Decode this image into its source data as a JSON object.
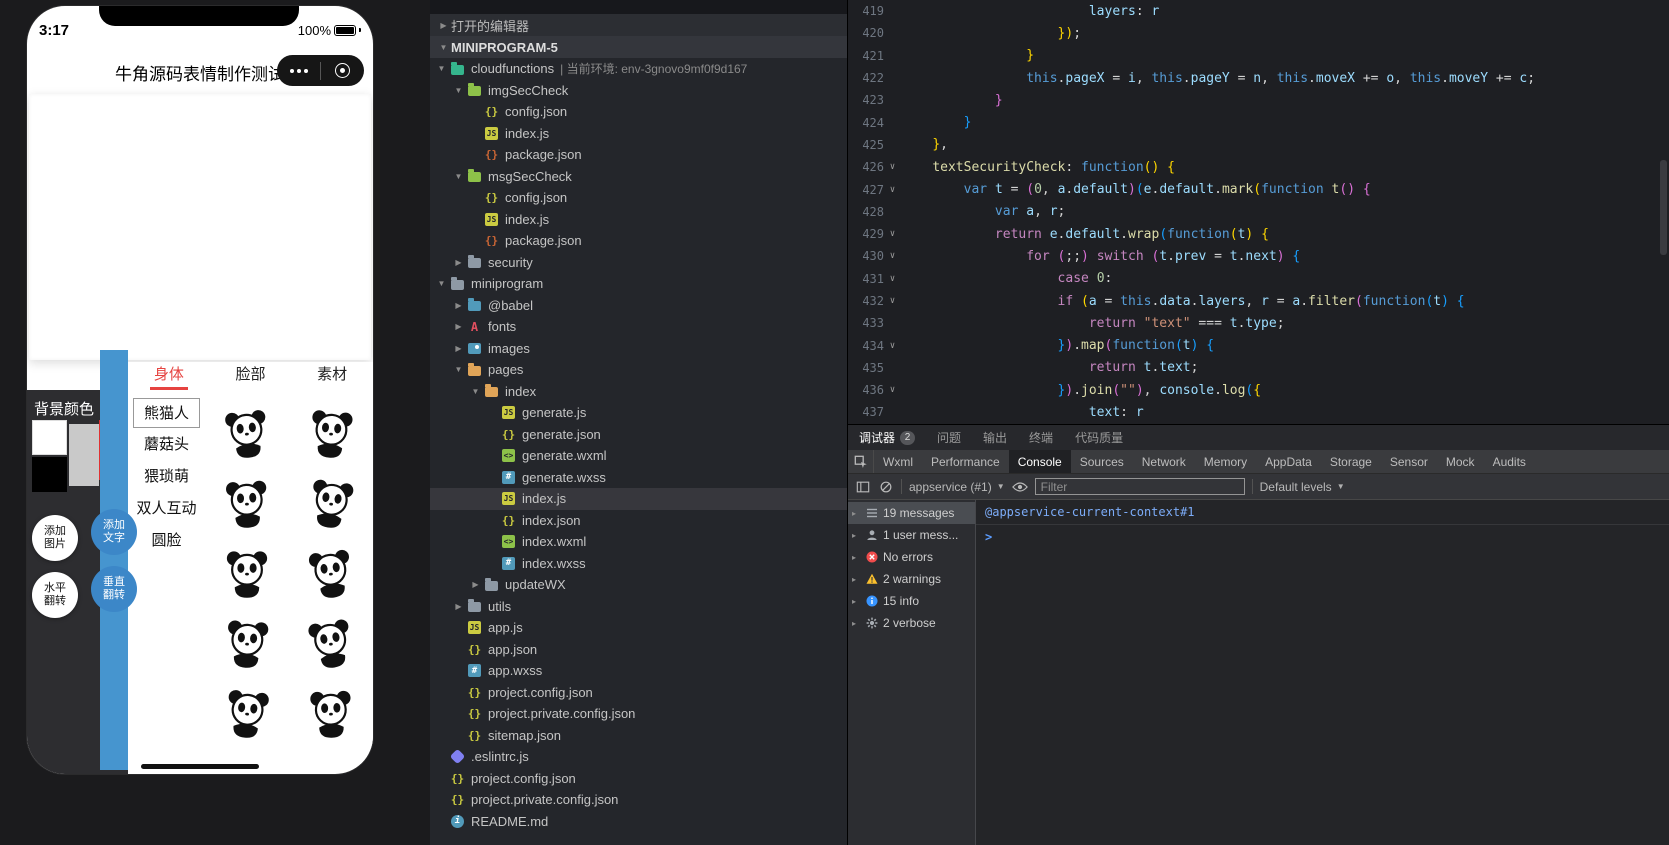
{
  "icons": {
    "collapsed": "▶",
    "expanded": "▼",
    "disclosure": "▸",
    "caret": "▼",
    "fold": "∨"
  },
  "simulator": {
    "status": {
      "time": "3:17",
      "battery": "100%"
    },
    "navbar": {
      "title": "牛角源码表情制作测试"
    },
    "sheet_tabs": [
      {
        "label": "身体",
        "active": true
      },
      {
        "label": "脸部",
        "active": false
      },
      {
        "label": "素材",
        "active": false
      }
    ],
    "bg_color_label": "背景颜色",
    "swatches": [
      "#ffffff",
      "#c9c9c9",
      "#000000"
    ],
    "categories": [
      {
        "label": "熊猫人",
        "selected": true
      },
      {
        "label": "蘑菇头",
        "selected": false
      },
      {
        "label": "猥琐萌",
        "selected": false
      },
      {
        "label": "双人互动",
        "selected": false
      },
      {
        "label": "圆脸",
        "selected": false
      }
    ],
    "action_buttons": [
      {
        "label": "添加图片",
        "style": "white"
      },
      {
        "label": "添加文字",
        "style": "blue"
      },
      {
        "label": "水平翻转",
        "style": "white"
      },
      {
        "label": "垂直翻转",
        "style": "blue"
      }
    ],
    "stickers": {
      "count": 10,
      "kind": "panda-sticker"
    },
    "accent_blue": "#4695cf",
    "tab_red": "#e64340"
  },
  "explorer": {
    "open_editors_label": "打开的编辑器",
    "root_label": "MINIPROGRAM-5",
    "items": [
      {
        "indent": 0,
        "arrow": "open",
        "icon": "folder-cloud",
        "label": "cloudfunctions",
        "note": "| 当前环境: env-3gnovo9mf0f9d167"
      },
      {
        "indent": 1,
        "arrow": "open",
        "icon": "folder-green",
        "label": "imgSecCheck"
      },
      {
        "indent": 2,
        "icon": "file-json",
        "label": "config.json"
      },
      {
        "indent": 2,
        "icon": "file-js",
        "label": "index.js"
      },
      {
        "indent": 2,
        "icon": "file-pkg",
        "label": "package.json"
      },
      {
        "indent": 1,
        "arrow": "open",
        "icon": "folder-green",
        "label": "msgSecCheck"
      },
      {
        "indent": 2,
        "icon": "file-json",
        "label": "config.json"
      },
      {
        "indent": 2,
        "icon": "file-js",
        "label": "index.js"
      },
      {
        "indent": 2,
        "icon": "file-pkg",
        "label": "package.json"
      },
      {
        "indent": 1,
        "arrow": "closed",
        "icon": "folder-gray",
        "label": "security"
      },
      {
        "indent": 0,
        "arrow": "open",
        "icon": "folder-gray",
        "label": "miniprogram"
      },
      {
        "indent": 1,
        "arrow": "closed",
        "icon": "folder-blue",
        "label": "@babel"
      },
      {
        "indent": 1,
        "arrow": "closed",
        "icon": "fonts-icon",
        "label": "fonts"
      },
      {
        "indent": 1,
        "arrow": "closed",
        "icon": "images-icon",
        "label": "images"
      },
      {
        "indent": 1,
        "arrow": "open",
        "icon": "folder-orange",
        "label": "pages"
      },
      {
        "indent": 2,
        "arrow": "open",
        "icon": "folder-orange",
        "label": "index"
      },
      {
        "indent": 3,
        "icon": "file-js",
        "label": "generate.js"
      },
      {
        "indent": 3,
        "icon": "file-json",
        "label": "generate.json"
      },
      {
        "indent": 3,
        "icon": "file-wxml",
        "label": "generate.wxml"
      },
      {
        "indent": 3,
        "icon": "file-wxss",
        "label": "generate.wxss"
      },
      {
        "indent": 3,
        "icon": "file-js",
        "label": "index.js",
        "selected": true
      },
      {
        "indent": 3,
        "icon": "file-json",
        "label": "index.json"
      },
      {
        "indent": 3,
        "icon": "file-wxml",
        "label": "index.wxml"
      },
      {
        "indent": 3,
        "icon": "file-wxss",
        "label": "index.wxss"
      },
      {
        "indent": 2,
        "arrow": "closed",
        "icon": "folder-gray",
        "label": "updateWX"
      },
      {
        "indent": 1,
        "arrow": "closed",
        "icon": "folder-gray",
        "label": "utils"
      },
      {
        "indent": 1,
        "icon": "file-js",
        "label": "app.js"
      },
      {
        "indent": 1,
        "icon": "file-json",
        "label": "app.json"
      },
      {
        "indent": 1,
        "icon": "file-wxss",
        "label": "app.wxss"
      },
      {
        "indent": 1,
        "icon": "file-json",
        "label": "project.config.json"
      },
      {
        "indent": 1,
        "icon": "file-json",
        "label": "project.private.config.json"
      },
      {
        "indent": 1,
        "icon": "file-json",
        "label": "sitemap.json"
      },
      {
        "indent": 0,
        "icon": "file-eslint",
        "label": ".eslintrc.js"
      },
      {
        "indent": 0,
        "icon": "file-json",
        "label": "project.config.json"
      },
      {
        "indent": 0,
        "icon": "file-json",
        "label": "project.private.config.json"
      },
      {
        "indent": 0,
        "icon": "file-readme",
        "label": "README.md"
      }
    ]
  },
  "editor": {
    "lines": [
      {
        "n": 419,
        "i": 24,
        "t": [
          [
            "layers",
            "vr"
          ],
          [
            ": ",
            "pln"
          ],
          [
            "r",
            "vr"
          ]
        ]
      },
      {
        "n": 420,
        "i": 20,
        "t": [
          [
            "})",
            "b1"
          ],
          [
            ";",
            "pln"
          ]
        ]
      },
      {
        "n": 421,
        "i": 16,
        "t": [
          [
            "}",
            "b1"
          ]
        ]
      },
      {
        "n": 422,
        "i": 16,
        "t": [
          [
            "this",
            "kw"
          ],
          [
            ".",
            "pln"
          ],
          [
            "pageX",
            "vr"
          ],
          [
            " = ",
            "pln"
          ],
          [
            "i",
            "vr"
          ],
          [
            ", ",
            "pln"
          ],
          [
            "this",
            "kw"
          ],
          [
            ".",
            "pln"
          ],
          [
            "pageY",
            "vr"
          ],
          [
            " = ",
            "pln"
          ],
          [
            "n",
            "vr"
          ],
          [
            ", ",
            "pln"
          ],
          [
            "this",
            "kw"
          ],
          [
            ".",
            "pln"
          ],
          [
            "moveX",
            "vr"
          ],
          [
            " += ",
            "pln"
          ],
          [
            "o",
            "vr"
          ],
          [
            ", ",
            "pln"
          ],
          [
            "this",
            "kw"
          ],
          [
            ".",
            "pln"
          ],
          [
            "moveY",
            "vr"
          ],
          [
            " += ",
            "pln"
          ],
          [
            "c",
            "vr"
          ],
          [
            ";",
            "pln"
          ]
        ]
      },
      {
        "n": 423,
        "i": 12,
        "t": [
          [
            "}",
            "b2"
          ]
        ]
      },
      {
        "n": 424,
        "i": 8,
        "t": [
          [
            "}",
            "b3"
          ]
        ]
      },
      {
        "n": 425,
        "i": 4,
        "t": [
          [
            "}",
            "b1"
          ],
          [
            ",",
            "pln"
          ]
        ]
      },
      {
        "n": 426,
        "i": 4,
        "f": true,
        "t": [
          [
            "textSecurityCheck",
            "fn"
          ],
          [
            ": ",
            "pln"
          ],
          [
            "function",
            "kw"
          ],
          [
            "()",
            "b1"
          ],
          [
            " ",
            "pln"
          ],
          [
            "{",
            "b1"
          ]
        ]
      },
      {
        "n": 427,
        "i": 8,
        "f": true,
        "t": [
          [
            "var",
            "kw"
          ],
          [
            " ",
            "pln"
          ],
          [
            "t",
            "vr"
          ],
          [
            " = ",
            "pln"
          ],
          [
            "(",
            "b2"
          ],
          [
            "0",
            "num"
          ],
          [
            ", ",
            "pln"
          ],
          [
            "a",
            "vr"
          ],
          [
            ".",
            "pln"
          ],
          [
            "default",
            "vr"
          ],
          [
            ")",
            "b2"
          ],
          [
            "(",
            "b3"
          ],
          [
            "e",
            "vr"
          ],
          [
            ".",
            "pln"
          ],
          [
            "default",
            "vr"
          ],
          [
            ".",
            "pln"
          ],
          [
            "mark",
            "fn"
          ],
          [
            "(",
            "b1"
          ],
          [
            "function",
            "kw"
          ],
          [
            " ",
            "pln"
          ],
          [
            "t",
            "fn"
          ],
          [
            "()",
            "b2"
          ],
          [
            " ",
            "pln"
          ],
          [
            "{",
            "b2"
          ]
        ]
      },
      {
        "n": 428,
        "i": 12,
        "t": [
          [
            "var",
            "kw"
          ],
          [
            " ",
            "pln"
          ],
          [
            "a",
            "vr"
          ],
          [
            ", ",
            "pln"
          ],
          [
            "r",
            "vr"
          ],
          [
            ";",
            "pln"
          ]
        ]
      },
      {
        "n": 429,
        "i": 12,
        "f": true,
        "t": [
          [
            "return",
            "ctrl"
          ],
          [
            " ",
            "pln"
          ],
          [
            "e",
            "vr"
          ],
          [
            ".",
            "pln"
          ],
          [
            "default",
            "vr"
          ],
          [
            ".",
            "pln"
          ],
          [
            "wrap",
            "fn"
          ],
          [
            "(",
            "b3"
          ],
          [
            "function",
            "kw"
          ],
          [
            "(",
            "b1"
          ],
          [
            "t",
            "vr"
          ],
          [
            ")",
            "b1"
          ],
          [
            " ",
            "pln"
          ],
          [
            "{",
            "b1"
          ]
        ]
      },
      {
        "n": 430,
        "i": 16,
        "f": true,
        "t": [
          [
            "for",
            "ctrl"
          ],
          [
            " ",
            "pln"
          ],
          [
            "(",
            "b2"
          ],
          [
            ";;",
            "pln"
          ],
          [
            ")",
            "b2"
          ],
          [
            " ",
            "pln"
          ],
          [
            "switch",
            "ctrl"
          ],
          [
            " ",
            "pln"
          ],
          [
            "(",
            "b2"
          ],
          [
            "t",
            "vr"
          ],
          [
            ".",
            "pln"
          ],
          [
            "prev",
            "vr"
          ],
          [
            " = ",
            "pln"
          ],
          [
            "t",
            "vr"
          ],
          [
            ".",
            "pln"
          ],
          [
            "next",
            "vr"
          ],
          [
            ")",
            "b2"
          ],
          [
            " ",
            "pln"
          ],
          [
            "{",
            "b3"
          ]
        ]
      },
      {
        "n": 431,
        "i": 20,
        "f": true,
        "t": [
          [
            "case",
            "ctrl"
          ],
          [
            " ",
            "pln"
          ],
          [
            "0",
            "num"
          ],
          [
            ":",
            "pln"
          ]
        ]
      },
      {
        "n": 432,
        "i": 20,
        "f": true,
        "t": [
          [
            "if",
            "ctrl"
          ],
          [
            " ",
            "pln"
          ],
          [
            "(",
            "b1"
          ],
          [
            "a",
            "vr"
          ],
          [
            " = ",
            "pln"
          ],
          [
            "this",
            "kw"
          ],
          [
            ".",
            "pln"
          ],
          [
            "data",
            "vr"
          ],
          [
            ".",
            "pln"
          ],
          [
            "layers",
            "vr"
          ],
          [
            ", ",
            "pln"
          ],
          [
            "r",
            "vr"
          ],
          [
            " = ",
            "pln"
          ],
          [
            "a",
            "vr"
          ],
          [
            ".",
            "pln"
          ],
          [
            "filter",
            "fn"
          ],
          [
            "(",
            "b2"
          ],
          [
            "function",
            "kw"
          ],
          [
            "(",
            "b3"
          ],
          [
            "t",
            "vr"
          ],
          [
            ")",
            "b3"
          ],
          [
            " ",
            "pln"
          ],
          [
            "{",
            "b3"
          ]
        ]
      },
      {
        "n": 433,
        "i": 24,
        "t": [
          [
            "return",
            "ctrl"
          ],
          [
            " ",
            "pln"
          ],
          [
            "\"text\"",
            "str"
          ],
          [
            " === ",
            "pln"
          ],
          [
            "t",
            "vr"
          ],
          [
            ".",
            "pln"
          ],
          [
            "type",
            "vr"
          ],
          [
            ";",
            "pln"
          ]
        ]
      },
      {
        "n": 434,
        "i": 20,
        "f": true,
        "t": [
          [
            "}",
            "b3"
          ],
          [
            ")",
            "b2"
          ],
          [
            ".",
            "pln"
          ],
          [
            "map",
            "fn"
          ],
          [
            "(",
            "b2"
          ],
          [
            "function",
            "kw"
          ],
          [
            "(",
            "b3"
          ],
          [
            "t",
            "vr"
          ],
          [
            ")",
            "b3"
          ],
          [
            " ",
            "pln"
          ],
          [
            "{",
            "b3"
          ]
        ]
      },
      {
        "n": 435,
        "i": 24,
        "t": [
          [
            "return",
            "ctrl"
          ],
          [
            " ",
            "pln"
          ],
          [
            "t",
            "vr"
          ],
          [
            ".",
            "pln"
          ],
          [
            "text",
            "vr"
          ],
          [
            ";",
            "pln"
          ]
        ]
      },
      {
        "n": 436,
        "i": 20,
        "f": true,
        "t": [
          [
            "}",
            "b3"
          ],
          [
            ")",
            "b2"
          ],
          [
            ".",
            "pln"
          ],
          [
            "join",
            "fn"
          ],
          [
            "(",
            "b2"
          ],
          [
            "\"\"",
            "str"
          ],
          [
            ")",
            "b2"
          ],
          [
            ", ",
            "pln"
          ],
          [
            "console",
            "vr"
          ],
          [
            ".",
            "pln"
          ],
          [
            "log",
            "fn"
          ],
          [
            "(",
            "b3"
          ],
          [
            "{",
            "b1"
          ]
        ]
      },
      {
        "n": 437,
        "i": 24,
        "t": [
          [
            "text",
            "vr"
          ],
          [
            ": ",
            "pln"
          ],
          [
            "r",
            "vr"
          ]
        ]
      }
    ]
  },
  "devtools": {
    "tabs": [
      {
        "label": "调试器",
        "badge": "2",
        "active": true
      },
      {
        "label": "问题",
        "active": false
      },
      {
        "label": "输出",
        "active": false
      },
      {
        "label": "终端",
        "active": false
      },
      {
        "label": "代码质量",
        "active": false
      }
    ],
    "panels": [
      "Wxml",
      "Performance",
      "Console",
      "Sources",
      "Network",
      "Memory",
      "AppData",
      "Storage",
      "Sensor",
      "Mock",
      "Audits"
    ],
    "active_panel": "Console",
    "toolbar": {
      "context": "appservice (#1)",
      "filter_placeholder": "Filter",
      "levels": "Default levels"
    },
    "sidebar": [
      {
        "icon": "list",
        "label": "19 messages",
        "selected": true
      },
      {
        "icon": "user",
        "label": "1 user mess...",
        "selected": false
      },
      {
        "icon": "error",
        "label": "No errors",
        "selected": false
      },
      {
        "icon": "warning",
        "label": "2 warnings",
        "selected": false
      },
      {
        "icon": "info",
        "label": "15 info",
        "selected": false
      },
      {
        "icon": "verbose",
        "label": "2 verbose",
        "selected": false
      }
    ],
    "output_context": "@appservice-current-context#1",
    "prompt": ">"
  }
}
